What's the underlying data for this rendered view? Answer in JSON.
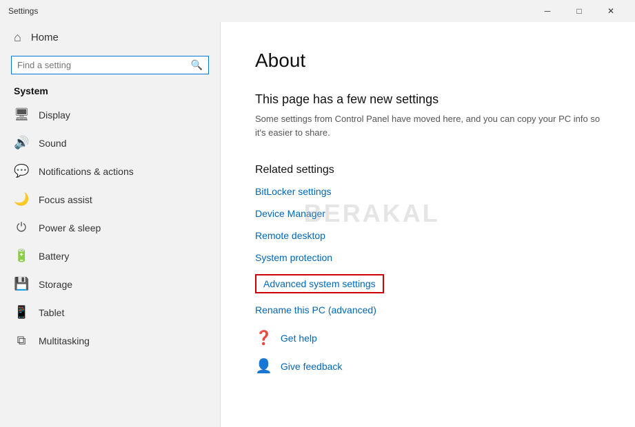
{
  "titlebar": {
    "title": "Settings",
    "minimize": "─",
    "maximize": "□",
    "close": "✕"
  },
  "sidebar": {
    "home_label": "Home",
    "search_placeholder": "Find a setting",
    "section_label": "System",
    "nav_items": [
      {
        "id": "display",
        "icon": "🖥",
        "label": "Display"
      },
      {
        "id": "sound",
        "icon": "🔊",
        "label": "Sound"
      },
      {
        "id": "notifications",
        "icon": "💬",
        "label": "Notifications & actions"
      },
      {
        "id": "focus",
        "icon": "🌙",
        "label": "Focus assist"
      },
      {
        "id": "power",
        "icon": "⏻",
        "label": "Power & sleep"
      },
      {
        "id": "battery",
        "icon": "🔋",
        "label": "Battery"
      },
      {
        "id": "storage",
        "icon": "💾",
        "label": "Storage"
      },
      {
        "id": "tablet",
        "icon": "📱",
        "label": "Tablet"
      },
      {
        "id": "multitasking",
        "icon": "⧉",
        "label": "Multitasking"
      }
    ]
  },
  "main": {
    "page_title": "About",
    "notice_title": "This page has a few new settings",
    "notice_text": "Some settings from Control Panel have moved here, and you can copy your PC info so it's easier to share.",
    "related_title": "Related settings",
    "related_links": [
      {
        "id": "bitlocker",
        "label": "BitLocker settings",
        "highlighted": false
      },
      {
        "id": "device-manager",
        "label": "Device Manager",
        "highlighted": false
      },
      {
        "id": "remote-desktop",
        "label": "Remote desktop",
        "highlighted": false
      },
      {
        "id": "system-protection",
        "label": "System protection",
        "highlighted": false
      },
      {
        "id": "advanced-system",
        "label": "Advanced system settings",
        "highlighted": true
      },
      {
        "id": "rename-pc",
        "label": "Rename this PC (advanced)",
        "highlighted": false
      }
    ],
    "bottom_links": [
      {
        "id": "get-help",
        "icon": "❓",
        "label": "Get help"
      },
      {
        "id": "give-feedback",
        "icon": "👤",
        "label": "Give feedback"
      }
    ]
  },
  "watermark": {
    "text": "BERAKAL"
  }
}
